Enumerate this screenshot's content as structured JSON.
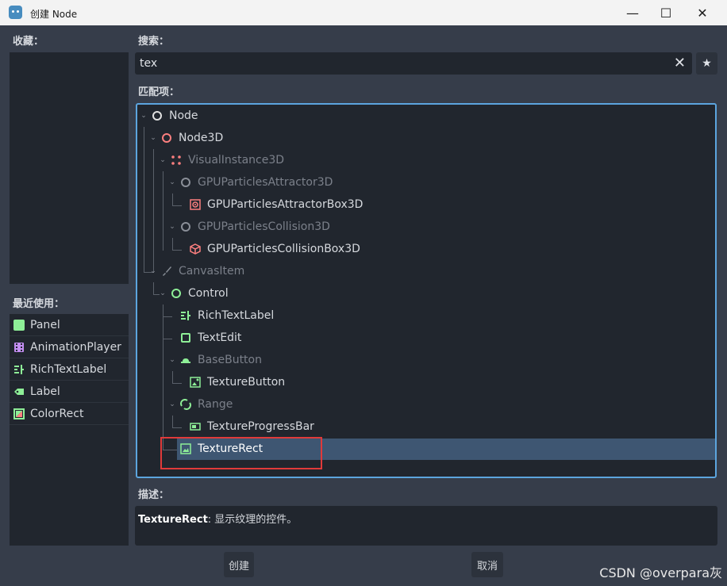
{
  "window": {
    "title": "创建 Node",
    "controls": [
      "—",
      "☐",
      "✕"
    ]
  },
  "favorites": {
    "label": "收藏："
  },
  "recent": {
    "label": "最近使用：",
    "items": [
      {
        "label": "Panel",
        "icon": "panel-icon",
        "color": "#8eef97"
      },
      {
        "label": "AnimationPlayer",
        "icon": "animation-player-icon",
        "color": "#c38ef1"
      },
      {
        "label": "RichTextLabel",
        "icon": "rich-text-label-icon",
        "color": "#8eef97"
      },
      {
        "label": "Label",
        "icon": "label-icon",
        "color": "#8eef97"
      },
      {
        "label": "ColorRect",
        "icon": "color-rect-icon",
        "color": "#8eef97"
      }
    ]
  },
  "search": {
    "label": "搜索：",
    "value": "tex",
    "clear": "✕",
    "favorite": "★"
  },
  "matches": {
    "label": "匹配项：",
    "nodes": [
      {
        "label": "Node",
        "icon": "node-icon",
        "dim": false,
        "color": "#e0e0e0"
      },
      {
        "label": "Node3D",
        "icon": "node3d-icon",
        "dim": false,
        "color": "#fc7f7f"
      },
      {
        "label": "VisualInstance3D",
        "icon": "visual-instance-3d-icon",
        "dim": true,
        "color": "#fc7f7f"
      },
      {
        "label": "GPUParticlesAttractor3D",
        "icon": "gpu-particles-attractor-3d-icon",
        "dim": true,
        "color": "#8a8f98"
      },
      {
        "label": "GPUParticlesAttractorBox3D",
        "icon": "gpu-particles-attractor-box-3d-icon",
        "dim": false,
        "color": "#fc7f7f"
      },
      {
        "label": "GPUParticlesCollision3D",
        "icon": "gpu-particles-collision-3d-icon",
        "dim": true,
        "color": "#8a8f98"
      },
      {
        "label": "GPUParticlesCollisionBox3D",
        "icon": "gpu-particles-collision-box-3d-icon",
        "dim": false,
        "color": "#fc7f7f"
      },
      {
        "label": "CanvasItem",
        "icon": "canvas-item-icon",
        "dim": true,
        "color": "#8a8f98"
      },
      {
        "label": "Control",
        "icon": "control-icon",
        "dim": false,
        "color": "#8eef97"
      },
      {
        "label": "RichTextLabel",
        "icon": "rich-text-label-icon",
        "dim": false,
        "color": "#8eef97"
      },
      {
        "label": "TextEdit",
        "icon": "text-edit-icon",
        "dim": false,
        "color": "#8eef97"
      },
      {
        "label": "BaseButton",
        "icon": "base-button-icon",
        "dim": true,
        "color": "#8eef97"
      },
      {
        "label": "TextureButton",
        "icon": "texture-button-icon",
        "dim": false,
        "color": "#8eef97"
      },
      {
        "label": "Range",
        "icon": "range-icon",
        "dim": true,
        "color": "#8eef97"
      },
      {
        "label": "TextureProgressBar",
        "icon": "texture-progress-bar-icon",
        "dim": false,
        "color": "#8eef97"
      },
      {
        "label": "TextureRect",
        "icon": "texture-rect-icon",
        "dim": false,
        "color": "#8eef97",
        "selected": true
      }
    ]
  },
  "description": {
    "label": "描述：",
    "name": "TextureRect",
    "text": ": 显示纹理的控件。"
  },
  "buttons": {
    "create": "创建",
    "cancel": "取消"
  },
  "watermark": "CSDN @overpara灰"
}
